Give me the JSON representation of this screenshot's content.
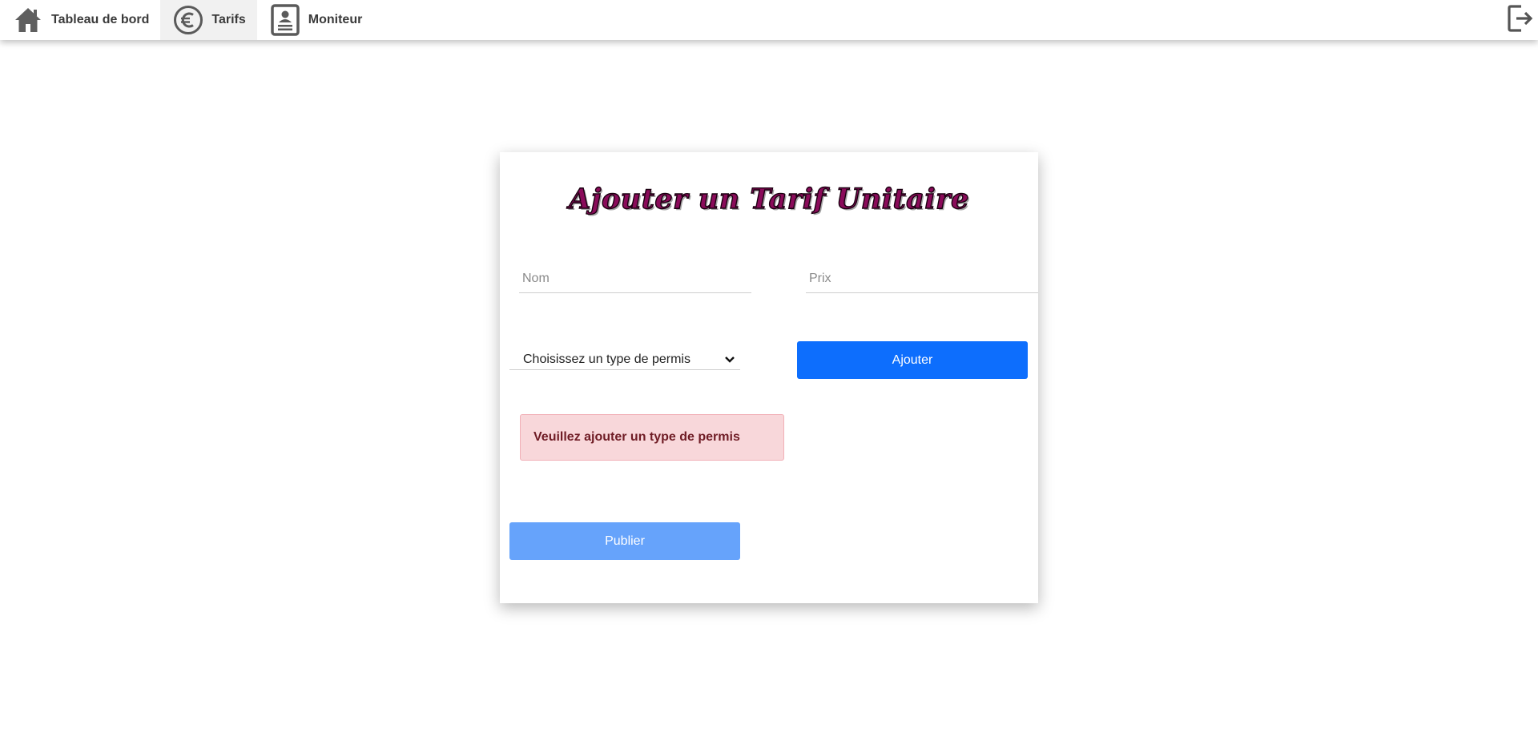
{
  "nav": {
    "items": [
      {
        "label": "Tableau de bord",
        "icon": "home-icon",
        "active": false
      },
      {
        "label": "Tarifs",
        "icon": "euro-icon",
        "active": true
      },
      {
        "label": "Moniteur",
        "icon": "contact-card-icon",
        "active": false
      }
    ],
    "logout_icon": "logout-icon"
  },
  "form": {
    "title": "Ajouter un Tarif Unitaire",
    "nom_placeholder": "Nom",
    "prix_placeholder": "Prix",
    "nom_value": "",
    "prix_value": "",
    "permis_select": "Choisissez un type de permis",
    "ajouter_label": "Ajouter",
    "alert_text": "Veuillez ajouter un type de permis",
    "publier_label": "Publier"
  },
  "colors": {
    "title": "#8a0b5a",
    "primary": "#0d6efd",
    "primary_disabled": "#66a3fb",
    "alert_bg": "#f8d7da",
    "alert_text": "#6f1c25"
  }
}
